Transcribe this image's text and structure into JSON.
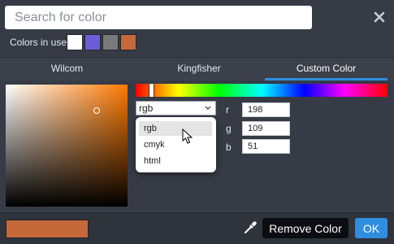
{
  "search": {
    "placeholder": "Search for color",
    "value": ""
  },
  "colors_in_use": {
    "label": "Colors in use",
    "swatches": [
      "#ffffff",
      "#6a5fd6",
      "#7a7a7a",
      "#c6693a"
    ]
  },
  "tabs": [
    {
      "label": "Wilcom",
      "active": false
    },
    {
      "label": "Kingfisher",
      "active": false
    },
    {
      "label": "Custom Color",
      "active": true
    }
  ],
  "picker": {
    "mode_selected": "rgb",
    "modes": [
      "rgb",
      "cmyk",
      "html"
    ],
    "hovered_mode": "rgb",
    "channels": [
      {
        "label": "r",
        "value": "198"
      },
      {
        "label": "g",
        "value": "109"
      },
      {
        "label": "b",
        "value": "51"
      }
    ]
  },
  "footer": {
    "current_color": "#c6693a",
    "remove_label": "Remove Color",
    "ok_label": "OK"
  },
  "colors": {
    "accent": "#2f8ee0",
    "panel": "#363b46"
  },
  "icons": [
    "close-icon",
    "chevron-down-icon",
    "eyedropper-icon",
    "mouse-cursor-icon"
  ]
}
